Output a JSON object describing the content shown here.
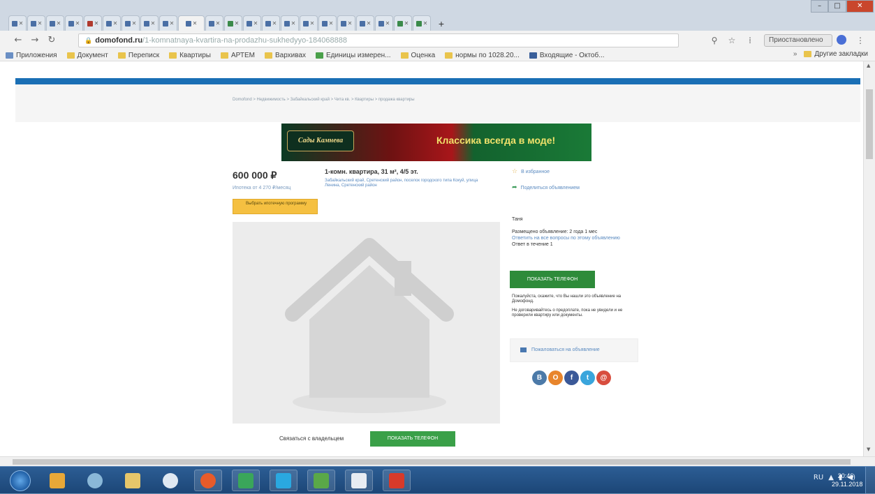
{
  "browser": {
    "tabs": [
      {
        "favicon": "house-favicon"
      },
      {
        "favicon": "house-favicon"
      },
      {
        "favicon": "house-favicon"
      },
      {
        "favicon": "grid-favicon"
      },
      {
        "favicon": "document-favicon"
      },
      {
        "favicon": "bird-favicon"
      },
      {
        "favicon": "bird-favicon"
      },
      {
        "favicon": "house-favicon"
      },
      {
        "favicon": "house-favicon"
      },
      {
        "favicon": "house-favicon",
        "active": true
      },
      {
        "favicon": "house-favicon"
      },
      {
        "favicon": "map-favicon"
      },
      {
        "favicon": "house-favicon"
      },
      {
        "favicon": "house-favicon"
      },
      {
        "favicon": "house-favicon"
      },
      {
        "favicon": "house-favicon"
      },
      {
        "favicon": "house-favicon"
      },
      {
        "favicon": "house-favicon"
      },
      {
        "favicon": "house-favicon"
      },
      {
        "favicon": "house-favicon"
      },
      {
        "favicon": "map-favicon"
      },
      {
        "favicon": "map-favicon"
      }
    ],
    "new_tab_label": "+",
    "address": {
      "domain": "domofond.ru",
      "path": "/1-komnatnaya-kvartira-na-prodazhu-sukhedyyo-184068888"
    },
    "profile_label": "Приостановлено",
    "bookmarks": [
      {
        "label": "Приложения",
        "icon": "apps-grid-icon"
      },
      {
        "label": "Документ",
        "icon": "folder-icon"
      },
      {
        "label": "Переписк",
        "icon": "folder-icon"
      },
      {
        "label": "Квартиры",
        "icon": "folder-icon"
      },
      {
        "label": "АРТЕМ",
        "icon": "folder-icon"
      },
      {
        "label": "Вархивах",
        "icon": "folder-icon"
      },
      {
        "label": "Единицы измерен...",
        "icon": "bookmark-page-icon"
      },
      {
        "label": "Оценка",
        "icon": "folder-icon"
      },
      {
        "label": "нормы по 1028.20...",
        "icon": "folder-icon"
      },
      {
        "label": "Входящие - Октоб...",
        "icon": "mail-icon"
      }
    ],
    "other_bookmarks_label": "Другие закладки"
  },
  "page": {
    "breadcrumb": "Domofond > Недвижимость > Забайкальский край > Чита кв. > Квартиры > продажа квартиры",
    "banner": {
      "logo_text": "Сады Камнева",
      "tagline": "Классика всегда в моде!"
    },
    "price": "600 000 ₽",
    "price_note": "Ипотека от 4 270 ₽/месяц",
    "yellow_button": "Выбрать ипотечную программу",
    "listing_title": "1-комн. квартира, 31 м², 4/5 эт.",
    "address": "Забайкальский край, Сретенский район, поселок городского типа Кокуй, улица Ленина, Сретенский район",
    "favorite_label": "В избранное",
    "share_label": "Поделиться объявлением",
    "contact": {
      "name": "Таня",
      "published": "Размещено объявление: 2 года 1 мес",
      "response": "Ответить на все вопросы по этому объявлению",
      "response_time": "Ответ в течение 1"
    },
    "show_phone_label": "ПОКАЗАТЬ ТЕЛЕФОН",
    "warning_1": "Пожалуйста, скажите, что Вы нашли это объявление на Домофонд.",
    "warning_2": "Не договаривайтесь о предоплате, пока не увидели и не проверили квартиру или документы.",
    "complaint_label": "Пожаловаться на объявление",
    "social_icons": [
      {
        "name": "vk-icon",
        "glyph": "В",
        "color": "#4c7aa8"
      },
      {
        "name": "ok-icon",
        "glyph": "О",
        "color": "#e8852c"
      },
      {
        "name": "facebook-icon",
        "glyph": "f",
        "color": "#3b5998"
      },
      {
        "name": "twitter-icon",
        "glyph": "t",
        "color": "#3aa5dc"
      },
      {
        "name": "email-icon",
        "glyph": "@",
        "color": "#d84d3e"
      }
    ],
    "contact_owner_label": "Связаться с владельцем",
    "bottom_button_label": "ПОКАЗАТЬ ТЕЛЕФОН"
  },
  "taskbar": {
    "apps": [
      {
        "name": "media-player-icon"
      },
      {
        "name": "explorer-icon"
      },
      {
        "name": "file-manager-icon"
      },
      {
        "name": "app-orange-icon"
      },
      {
        "name": "chrome-icon",
        "open": true
      },
      {
        "name": "skype-icon",
        "open": true
      },
      {
        "name": "excel-icon",
        "open": true
      },
      {
        "name": "calculator-icon",
        "open": true
      },
      {
        "name": "pdf-icon",
        "open": true
      },
      {
        "name": "image-viewer-icon",
        "open": true
      }
    ],
    "clock_time": "20:46",
    "clock_date": "29.11.2018"
  },
  "colors": {
    "site_blue": "#1a6fb5",
    "green_button": "#2e8b3a",
    "yellow_button": "#f5c041"
  }
}
